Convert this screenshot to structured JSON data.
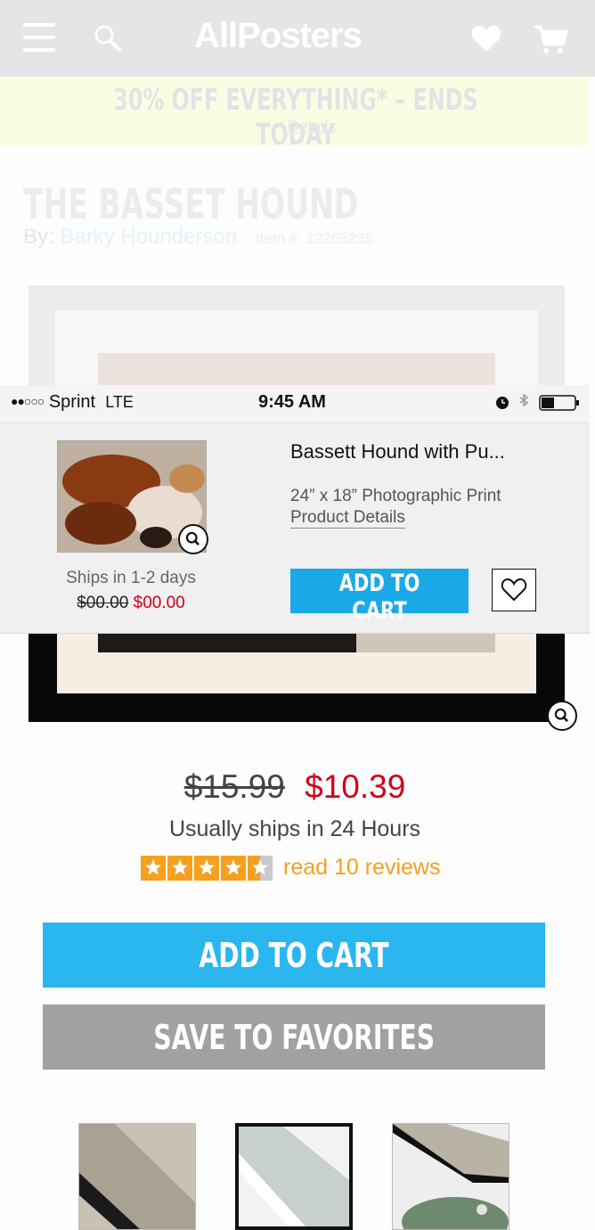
{
  "header": {
    "logo_text": "AllPosters",
    "icons": [
      "menu-icon",
      "search-icon",
      "heart-icon",
      "cart-icon"
    ]
  },
  "promo": {
    "headline": "30% OFF EVERYTHING* – ENDS TODAY",
    "details_link": "Details"
  },
  "product": {
    "title": "THE BASSET HOUND",
    "by_label": "By:",
    "artist": "Barky Hounderson",
    "item_label": "Item #: 12265235",
    "old_price": "$15.99",
    "new_price": "$10.39",
    "shipping": "Usually ships in 24 Hours",
    "rating_stars": 4.5,
    "reviews_link": "read 10 reviews",
    "add_to_cart": "ADD TO CART",
    "save_to_favorites": "SAVE TO FAVORITES"
  },
  "status_bar": {
    "signal": "●●○○○",
    "carrier": "Sprint",
    "network": "LTE",
    "time": "9:45 AM",
    "icons": [
      "alarm-icon",
      "bluetooth-icon",
      "battery-icon"
    ]
  },
  "sticky_bar": {
    "product_name": "Bassett Hound with Pu...",
    "size": "24” x 18” Photographic Print",
    "details_link": "Product  Details",
    "shipping": "Ships in 1-2 days",
    "old_price": "$00.00",
    "new_price": "$00.00",
    "add_to_cart": "ADD TO CART"
  },
  "colors": {
    "accent_blue": "#2ab6ef",
    "sale_red": "#d0021b",
    "review_orange": "#f5a01e",
    "favorites_gray": "#a1a1a1"
  }
}
